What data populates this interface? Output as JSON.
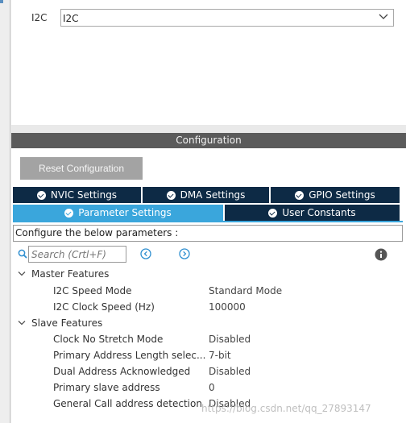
{
  "top": {
    "label": "I2C",
    "selected": "I2C"
  },
  "config": {
    "header": "Configuration",
    "reset_label": "Reset Configuration",
    "tabs": [
      {
        "label": "NVIC Settings"
      },
      {
        "label": "DMA Settings"
      },
      {
        "label": "GPIO Settings"
      },
      {
        "label": "Parameter Settings"
      },
      {
        "label": "User Constants"
      }
    ],
    "info_text": "Configure the below parameters :",
    "search_placeholder": "Search (Crtl+F)",
    "groups": [
      {
        "label": "Master Features",
        "params": [
          {
            "name": "I2C Speed Mode",
            "value": "Standard Mode"
          },
          {
            "name": "I2C Clock Speed (Hz)",
            "value": "100000"
          }
        ]
      },
      {
        "label": "Slave Features",
        "params": [
          {
            "name": "Clock No Stretch Mode",
            "value": "Disabled"
          },
          {
            "name": "Primary Address Length selec...",
            "value": "7-bit"
          },
          {
            "name": "Dual Address Acknowledged",
            "value": "Disabled"
          },
          {
            "name": "Primary slave address",
            "value": "0"
          },
          {
            "name": "General Call address detection",
            "value": "Disabled"
          }
        ]
      }
    ]
  },
  "watermark": "https://blog.csdn.net/qq_27893147",
  "colors": {
    "tab_dark": "#0d2a45",
    "tab_active": "#3aa6dc",
    "header_bg": "#5b5b5b",
    "reset_bg": "#a3a3a3"
  }
}
